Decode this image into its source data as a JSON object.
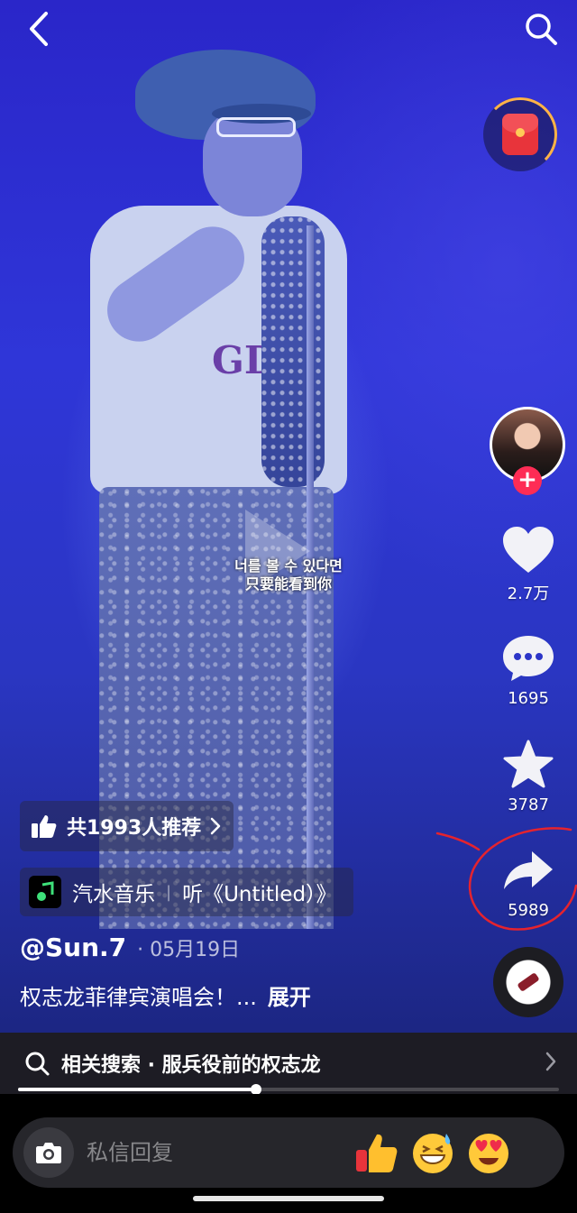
{
  "header": {
    "back_icon": "chevron-left-icon",
    "search_icon": "search-icon"
  },
  "video": {
    "subtitle_line1": "너를 볼 수 있다면",
    "subtitle_line2": "只要能看到你",
    "shirt_text": "GD"
  },
  "sidebar": {
    "redpacket_icon": "red-envelope-icon",
    "like_count": "2.7万",
    "comment_count": "1695",
    "favorite_count": "3787",
    "share_count": "5989"
  },
  "recommend": {
    "label": "共1993人推荐"
  },
  "music": {
    "app_name": "汽水音乐",
    "listen_text": "听《Untitled）》"
  },
  "post": {
    "author": "@Sun.7",
    "date": "· 05月19日",
    "caption": "权志龙菲律宾演唱会！...",
    "expand_label": "展开"
  },
  "related_search": {
    "label": "相关搜索 · 服兵役前的权志龙"
  },
  "playback": {
    "progress": 0.44
  },
  "reply": {
    "placeholder": "私信回复"
  },
  "colors": {
    "accent": "#fe2c55",
    "annotation": "#e5232e"
  }
}
